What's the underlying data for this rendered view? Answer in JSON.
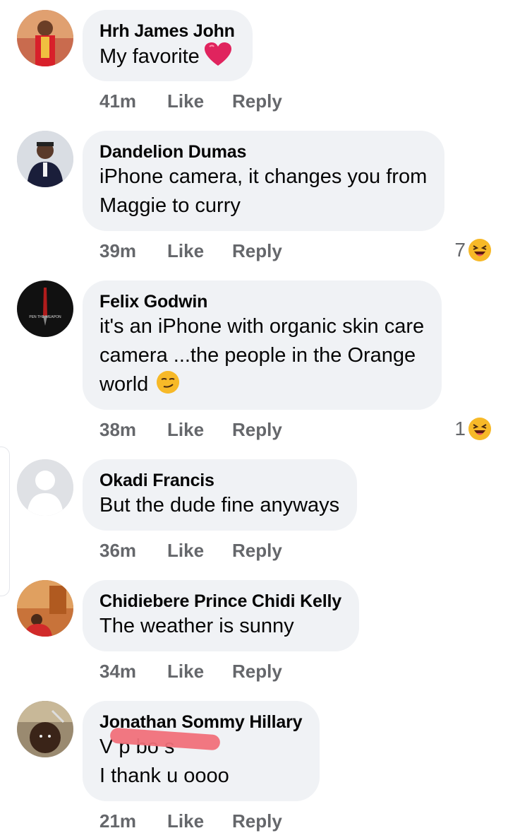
{
  "colors": {
    "bubble": "#f0f2f5",
    "meta": "#65676b",
    "text": "#050505",
    "heart": "#e0245e"
  },
  "comments": [
    {
      "author": "Hrh James John",
      "text_lines": [
        "My favorite"
      ],
      "emoji_after_text": "heart",
      "time": "41m",
      "like": "Like",
      "reply": "Reply"
    },
    {
      "author": "Dandelion Dumas",
      "text_lines": [
        "iPhone camera, it changes you from",
        "Maggie to curry"
      ],
      "time": "39m",
      "like": "Like",
      "reply": "Reply",
      "reaction": {
        "count": "7",
        "icon": "laughing-emoji-icon"
      }
    },
    {
      "author": "Felix Godwin",
      "text_lines": [
        "it's an iPhone with organic skin care",
        "camera ...the people in the Orange",
        "world"
      ],
      "emoji_after_text": "smirk",
      "time": "38m",
      "like": "Like",
      "reply": "Reply",
      "reaction": {
        "count": "1",
        "icon": "laughing-emoji-icon"
      }
    },
    {
      "author": "Okadi Francis",
      "text_lines": [
        "But the dude fine anyways"
      ],
      "time": "36m",
      "like": "Like",
      "reply": "Reply"
    },
    {
      "author": "Chidiebere Prince Chidi Kelly",
      "text_lines": [
        "The weather is sunny"
      ],
      "time": "34m",
      "like": "Like",
      "reply": "Reply"
    },
    {
      "author": "Jonathan Sommy Hillary",
      "text_lines": [
        "V p bo      s",
        "I thank u oooo"
      ],
      "time": "21m",
      "like": "Like",
      "reply": "Reply"
    }
  ],
  "avatar_logo_text": "PEN THE WEAPON"
}
